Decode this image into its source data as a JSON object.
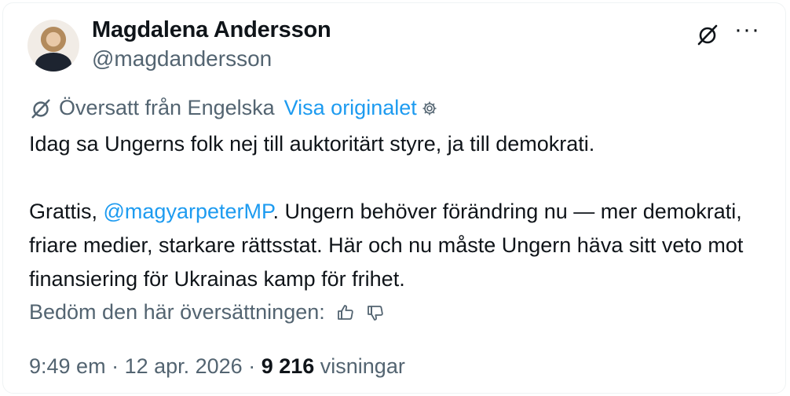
{
  "author": {
    "name": "Magdalena Andersson",
    "handle": "@magdandersson"
  },
  "translation": {
    "notice": "Översatt från Engelska",
    "show_original": "Visa originalet"
  },
  "post": {
    "line1": "Idag sa Ungerns folk nej till auktoritärt styre, ja till demokrati.",
    "p2_prefix": "Grattis, ",
    "mention": "@magyarpeterMP",
    "p2_suffix": ". Ungern behöver förändring nu — mer demokrati, friare medier, starkare rättsstat. Här och nu måste Ungern häva sitt veto mot finansiering för Ukrainas kamp för frihet."
  },
  "rating": {
    "label": "Bedöm den här översättningen:"
  },
  "meta": {
    "time": "9:49 em",
    "separator": " · ",
    "date": "12 apr. 2026",
    "views_count": "9 216",
    "views_label": " visningar"
  },
  "icons": {
    "translate": "translate-icon",
    "more": "more-icon",
    "gear": "gear-icon",
    "thumbs_up": "thumbs-up-icon",
    "thumbs_down": "thumbs-down-icon"
  },
  "colors": {
    "link": "#1d9bf0",
    "secondary_text": "#536471",
    "primary_text": "#0f1419"
  }
}
